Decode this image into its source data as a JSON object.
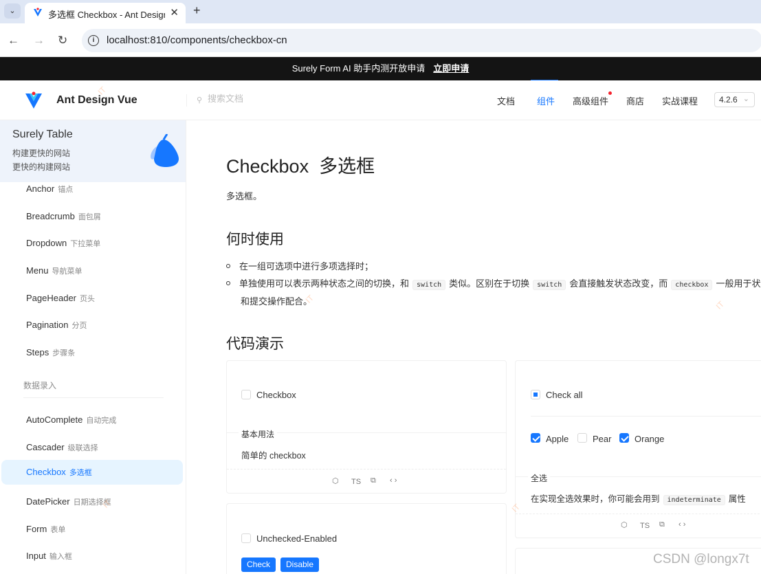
{
  "browser": {
    "tab_title": "多选框 Checkbox - Ant Design Vue",
    "new_tab": "+",
    "close": "✕",
    "url": "localhost:810/components/checkbox-cn",
    "back": "←",
    "forward": "→",
    "reload": "↻",
    "info": "i",
    "dropdown": "⌄"
  },
  "banner": {
    "text": "Surely Form AI 助手内测开放申请",
    "link": "立即申请"
  },
  "header": {
    "brand": "Ant Design Vue",
    "search_placeholder": "搜索文档",
    "menu": [
      "文档",
      "组件",
      "高级组件",
      "商店",
      "实战课程"
    ],
    "active_menu": "组件",
    "version": "4.2.6"
  },
  "sidebar": {
    "promo_title": "Surely Table",
    "promo_line1": "构建更快的网站",
    "promo_line2": "更快的构建网站",
    "items_top": [
      {
        "en": "Anchor",
        "zh": "锚点"
      },
      {
        "en": "Breadcrumb",
        "zh": "面包屑"
      },
      {
        "en": "Dropdown",
        "zh": "下拉菜单"
      },
      {
        "en": "Menu",
        "zh": "导航菜单"
      },
      {
        "en": "PageHeader",
        "zh": "页头"
      },
      {
        "en": "Pagination",
        "zh": "分页"
      },
      {
        "en": "Steps",
        "zh": "步骤条"
      }
    ],
    "group_title": "数据录入",
    "items_bottom": [
      {
        "en": "AutoComplete",
        "zh": "自动完成"
      },
      {
        "en": "Cascader",
        "zh": "级联选择"
      },
      {
        "en": "Checkbox",
        "zh": "多选框"
      },
      {
        "en": "DatePicker",
        "zh": "日期选择框"
      },
      {
        "en": "Form",
        "zh": "表单"
      },
      {
        "en": "Input",
        "zh": "输入框"
      }
    ]
  },
  "content": {
    "title_en": "Checkbox",
    "title_zh": "多选框",
    "subtitle": "多选框。",
    "when_to_use": "何时使用",
    "bullet1": "在一组可选项中进行多项选择时；",
    "bullet2_a": "单独使用可以表示两种状态之间的切换，和",
    "bullet2_code1": "switch",
    "bullet2_b": "类似。区别在于切换",
    "bullet2_code2": "switch",
    "bullet2_c": "会直接触发状态改变，而",
    "bullet2_code3": "checkbox",
    "bullet2_d": "一般用于状态标记",
    "bullet2_line2": "和提交操作配合。",
    "demos_title": "代码演示"
  },
  "demo_basic": {
    "checkbox_label": "Checkbox",
    "meta_title": "基本用法",
    "meta_desc": "简单的 checkbox",
    "actions": [
      "⬡",
      "TS",
      "⧉",
      "‹ ›"
    ]
  },
  "demo_checkall": {
    "check_all_label": "Check all",
    "options": [
      {
        "label": "Apple",
        "checked": true
      },
      {
        "label": "Pear",
        "checked": false
      },
      {
        "label": "Orange",
        "checked": true
      }
    ],
    "meta_title": "全选",
    "meta_desc_a": "在实现全选效果时，你可能会用到",
    "meta_desc_code": "indeterminate",
    "meta_desc_b": "属性",
    "actions": [
      "⬡",
      "TS",
      "⧉",
      "‹ ›"
    ]
  },
  "demo_controlled": {
    "checkbox_label": "Unchecked-Enabled",
    "btn_check": "Check",
    "btn_disable": "Disable"
  },
  "watermark": {
    "text": "IT",
    "credit": "CSDN @longx7t"
  },
  "colors": {
    "primary": "#1677ff",
    "banner_bg": "#141414",
    "active_bg": "#e6f4ff"
  }
}
